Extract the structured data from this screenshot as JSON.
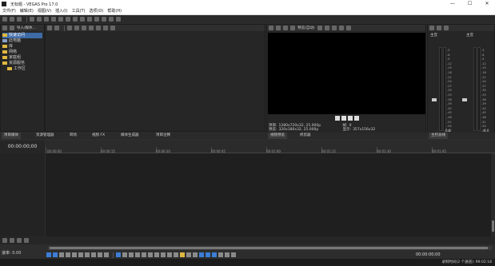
{
  "window": {
    "title": "无标题 - VEGAS Pro 17.0",
    "min": "—",
    "max": "☐",
    "close": "✕"
  },
  "menu": [
    "文件(F)",
    "编辑(E)",
    "视图(V)",
    "插入(I)",
    "工具(T)",
    "选项(O)",
    "帮助(H)"
  ],
  "explorer": {
    "path": "导入/媒体…",
    "tree": [
      {
        "label": "快速访问",
        "icon": "folder-icon",
        "selected": true
      },
      {
        "label": "此电脑",
        "icon": "computer-icon",
        "selected": false
      },
      {
        "label": "库",
        "icon": "folder-icon",
        "selected": false
      },
      {
        "label": "网络",
        "icon": "folder-icon",
        "selected": false
      },
      {
        "label": "家庭组",
        "icon": "folder-icon",
        "selected": false
      },
      {
        "label": "资源服务",
        "icon": "folder-icon",
        "selected": false
      },
      {
        "label": "工作区",
        "icon": "folder-icon",
        "selected": false
      }
    ]
  },
  "preview": {
    "toolbar_label": "预览(自动)",
    "info": {
      "project_label": "项目:",
      "project_value": "1280x720x32, 25.000p",
      "preview_label": "预览:",
      "preview_value": "320x180x32, 25.000p",
      "frame_label": "帧:",
      "frame_value": "0",
      "display_label": "显示:",
      "display_value": "357x156x32"
    }
  },
  "mixer": {
    "master_label": "主音",
    "bus_label": "主音",
    "scale": [
      "-3",
      "-6",
      "-9",
      "-12",
      "-15",
      "-18",
      "-21",
      "-24",
      "-27",
      "-30",
      "-33",
      "-36",
      "-39",
      "-42",
      "-45",
      "-48",
      "-51",
      "-54",
      "-57"
    ],
    "left_value": "0.0",
    "right_value": "0.0"
  },
  "tabs": [
    {
      "label": "项目媒体",
      "active": true
    },
    {
      "label": "资源管理器",
      "active": false
    },
    {
      "label": "转场",
      "active": false
    },
    {
      "label": "视频 FX",
      "active": false
    },
    {
      "label": "媒体生成器",
      "active": false
    },
    {
      "label": "项目注释",
      "active": false
    },
    {
      "label": "视频预览",
      "active": true
    },
    {
      "label": "修剪器",
      "active": false
    },
    {
      "label": "主控总线",
      "active": true
    }
  ],
  "timeline": {
    "timecode": "00:00:00;00",
    "ruler": [
      "00:00:00",
      "00:00:15",
      "00:00:30",
      "00:00:45",
      "00:01:00",
      "00:01:15",
      "00:01:30",
      "00:01:45"
    ],
    "rate_label": "速率: 0.00",
    "transport_time": "00:00:00;00"
  },
  "status": {
    "record_time": "录制时间(2 个通道): 99:02:18"
  }
}
